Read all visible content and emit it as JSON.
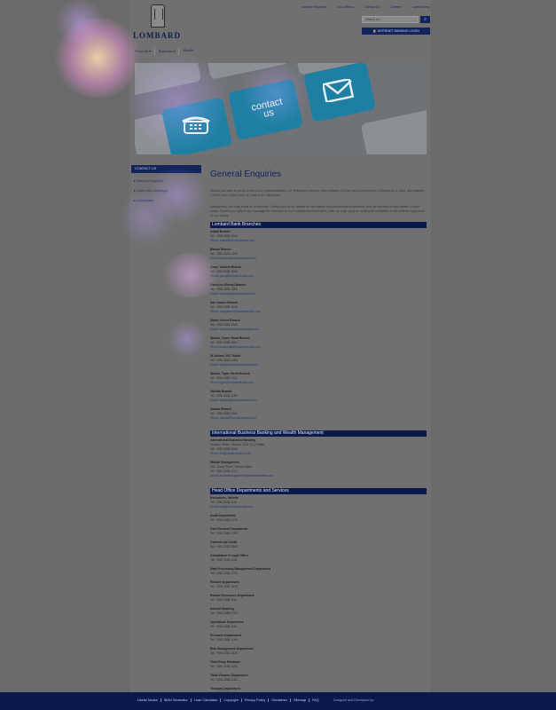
{
  "header": {
    "logo_text": "LOMBARD",
    "top_links": [
      "Investor Relations",
      "Our Offices",
      "Contact Us",
      "Careers",
      "Latest News"
    ],
    "search_placeholder": "Search for...",
    "internet_banking_label": "INTERNET BANKING LOGIN",
    "nav": [
      "Personal ▾",
      "Business ▾",
      "Wealth"
    ]
  },
  "hero": {
    "line1": "contact",
    "line2": "us"
  },
  "sidebar": {
    "heading": "CONTACT US",
    "items": [
      "General Enquiries",
      "Leave us a Message",
      "Complaints"
    ]
  },
  "content": {
    "title": "General Enquiries",
    "intro1": "Should you wish to speak to one of our representatives, our Telephone lines are open between 8.00am and 4.30pm from 1 October to 14 June, and between 7.45am and 2.30pm from 15 June to 30 September.",
    "intro2": "Alternatively, you may email us at any time. Should you do so, please do not include any confidential information, such as account or card details, in your email. Should you reply to any message the inclusion of such confidential information, then we shall apply for additional verification to the address registered on our books.",
    "sections": [
      {
        "heading": "Lombard Bank Branches",
        "entries": [
          {
            "name": "Attard Branch",
            "tel": "Tel: +356 2558 1560",
            "email": "Email: attard@lombardmalta.com"
          },
          {
            "name": "Balzan Branch",
            "tel": "Tel: +356 2558 1300",
            "email": "Email: balzan@lombardmalta.com"
          },
          {
            "name": "Gozo, Victoria Branch",
            "tel": "Tel: +356 2558 1600",
            "email": "Email: gozo@lombardmalta.com"
          },
          {
            "name": "Gzira (on Sliema) Branch",
            "tel": "Tel: +356 2558 1380",
            "email": "Email: sliema@lombardmalta.com"
          },
          {
            "name": "San Gwann Branch",
            "tel": "Tel: +356 2558 1640",
            "email": "Email: sangwann@lombardmalta.com"
          },
          {
            "name": "Santa Venera Branch",
            "tel": "Tel: +356 2558 1900",
            "email": "Email: stvenera@lombardmalta.com"
          },
          {
            "name": "Sliema, Tower Road Branch",
            "tel": "Tel: +356 2558 1582",
            "email": "Email: towerroad@lombardmalta.com"
          },
          {
            "name": "St.Julians 24/7 Outlet",
            "tel": "Tel: +356 2558 1480",
            "email": "Email: stjulians@lombardmalta.com"
          },
          {
            "name": "Sliema, Tigne Street Branch",
            "tel": "Tel: +356 2558 1211",
            "email": "Email: tigne@lombardmalta.com"
          },
          {
            "name": "Valletta Branch",
            "tel": "Tel: +356 2558 1180",
            "email": "Email: valletta@lombardmalta.com"
          },
          {
            "name": "Zabbar Branch",
            "tel": "Tel: +356 2558 1380",
            "email": "Email: zabbar@lombardmalta.com"
          }
        ]
      },
      {
        "heading": "International Business Banking and Wealth Management",
        "entries": [
          {
            "name": "International Business Banking",
            "addr": "Graham Street, Sliema, SLM 1712 Malta",
            "tel": "Tel: +356 2558 1556",
            "email": "Email: ibb@lombardmalta.com"
          },
          {
            "name": "Wealth Management",
            "addr": "101, Tower Road, Sliema Malta",
            "tel": "Tel: +356 2558 1212",
            "email": "Email: wealthmanagement@lombardmalta.com"
          }
        ]
      },
      {
        "heading": "Head Office Departments and Services",
        "entries": [
          {
            "name": "Executives, Valletta",
            "tel": "Tel: +356 2558 1151",
            "email": "Email: mail@lombardmalta.com"
          },
          {
            "name": "Audit Department",
            "tel": "Tel: +356 2558 1233"
          },
          {
            "name": "Card Services Department",
            "tel": "Tel: +356 2558 1789"
          },
          {
            "name": "Commercial Credit",
            "tel": "Tel: +356 2558 1865"
          },
          {
            "name": "Compliance & Legal Office",
            "tel": "Tel: +356 2558 1115"
          },
          {
            "name": "Data Processing Management Department",
            "tel": "Tel: +356 2558 1721"
          },
          {
            "name": "Finance Department",
            "tel": "Tel: +356 2558 1825"
          },
          {
            "name": "Human Resources Department",
            "tel": "Tel: +356 2558 1164"
          },
          {
            "name": "Internet Banking",
            "tel": "Tel: +356 2558 1789"
          },
          {
            "name": "Operations Department",
            "tel": "Tel: +356 2558 1160"
          },
          {
            "name": "Premises Department",
            "tel": "Tel: +356 2558 1166"
          },
          {
            "name": "Risk Management Department",
            "tel": "Tel: +356 2558 1826"
          },
          {
            "name": "Third Party Relations",
            "tel": "Tel: +356 2558 1361"
          },
          {
            "name": "Trade Finance Department",
            "tel": "Tel: +356 2558 1164"
          },
          {
            "name": "Treasury Department",
            "tel": "Tel: +356 2558 1145"
          }
        ]
      }
    ]
  },
  "footer": {
    "links": [
      "Useful Nodes",
      "IBAN Generator",
      "Loan Calculator",
      "Copyright",
      "Privacy Policy",
      "Disclaimer",
      "Sitemap",
      "FAQ"
    ],
    "credit": "Designed and Developed by"
  }
}
